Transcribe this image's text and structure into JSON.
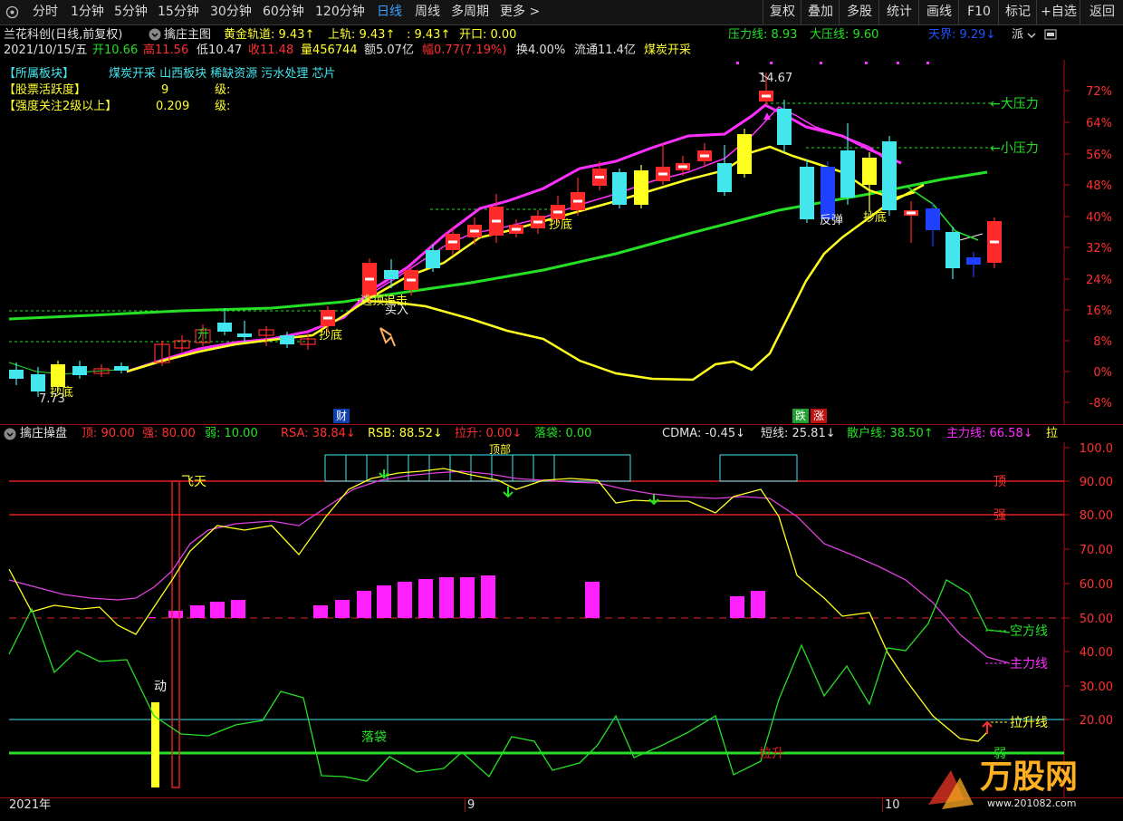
{
  "toolbar": {
    "left": [
      "分时",
      "1分钟",
      "5分钟",
      "15分钟",
      "30分钟",
      "60分钟",
      "120分钟",
      "日线",
      "周线",
      "多周期",
      "更多 >"
    ],
    "active": "日线",
    "right": [
      "复权",
      "叠加",
      "多股",
      "统计",
      "画线",
      "F10",
      "标记",
      "+自选",
      "返回"
    ]
  },
  "header": {
    "stock": "兰花科创(日线,前复权)",
    "indicator": "擒庄主图",
    "golden_rail_label": "黄金轨道: 9.43↑",
    "upper_rail_label": "上轨: 9.43↑",
    "mid_label": ": 9.43↑",
    "open_label": "开口: 0.00",
    "pressure_label": "压力线: 8.93",
    "big_pressure_label": "大压线: 9.60",
    "tianjie_label": "天界: 9.29↓",
    "collapse_label": "派"
  },
  "quote": {
    "date": "2021/10/15/五",
    "open": "开10.66",
    "high": "高11.56",
    "low": "低10.47",
    "close": "收11.48",
    "volume": "量456744",
    "amount": "额5.07亿",
    "range": "幅0.77(7.19%)",
    "turnover": "换4.00%",
    "float": "流通11.4亿",
    "sector": "煤炭开采"
  },
  "info": {
    "sector_title": "【所属板块】",
    "sectors": "煤炭开采 山西板块 稀缺资源 污水处理 芯片",
    "activity_title": "【股票活跃度】",
    "activity_value": "9",
    "activity_unit": "级:",
    "focus_title": "【强度关注2级以上】",
    "focus_value": "0.209",
    "focus_unit": "级:"
  },
  "main_chart": {
    "y_ticks": [
      "72%",
      "64%",
      "56%",
      "48%",
      "40%",
      "32%",
      "24%",
      "16%",
      "8%",
      "0%",
      "-8%"
    ],
    "high_label": "14.67",
    "low_label": "7.73",
    "labels": {
      "big_pressure": "←大压力",
      "small_pressure": "←小压力",
      "rebound": "反弹",
      "bottom1": "抄底",
      "bottom2": "抄底",
      "bottom3": "抄底",
      "bottom4": "抄底",
      "rise": "升",
      "chase": "逃顶追击",
      "buy": "买入",
      "cai": "财",
      "die": "跌",
      "zhang": "涨"
    }
  },
  "sub_header": {
    "name": "擒庄操盘",
    "top": "顶: 90.00",
    "strong": "强: 80.00",
    "weak": "弱: 10.00",
    "rsa": "RSA: 38.84↓",
    "rsb": "RSB: 88.52↓",
    "lift": "拉升: 0.00↓",
    "fall": "落袋: 0.00",
    "cdma": "CDMA: -0.45↓",
    "short": "短线: 25.81↓",
    "retail": "散户线: 38.50↑",
    "main": "主力线: 66.58↓",
    "la": "拉"
  },
  "sub_chart": {
    "y_ticks": [
      "100.0",
      "90.00",
      "80.00",
      "70.00",
      "60.00",
      "50.00",
      "40.00",
      "30.00",
      "20.00"
    ],
    "labels": {
      "top": "顶",
      "strong": "强",
      "weak": "弱",
      "short_line": "空方线",
      "main_line": "主力线",
      "lift_line": "拉升线",
      "fly": "飞天",
      "move": "动",
      "fall": "落袋",
      "lift": "拉升",
      "top_box": "顶部"
    }
  },
  "bottom_axis": {
    "labels": [
      "2021年",
      "9",
      "10"
    ]
  },
  "watermark": {
    "text": "万股网",
    "url": "www.201082.com"
  },
  "colors": {
    "up": "#ff2a2a",
    "down": "#44e6ee",
    "yellow": "#ffff20",
    "magenta": "#ff30ff",
    "green": "#25e025",
    "blue": "#2040ff",
    "cyan": "#44e6ee",
    "red_line": "#e02020"
  }
}
